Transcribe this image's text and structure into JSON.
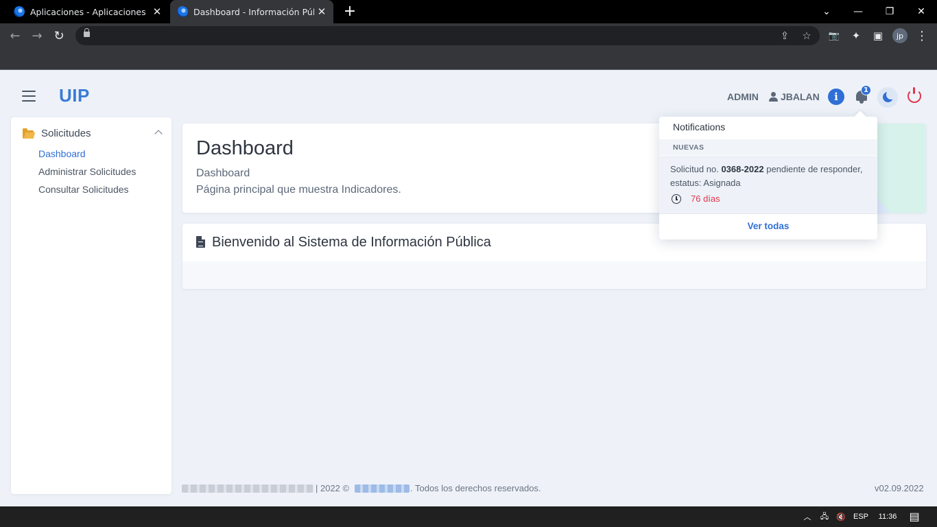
{
  "browser": {
    "tabs": [
      {
        "title": "Aplicaciones - Aplicaciones",
        "close": "✕"
      },
      {
        "title": "Dashboard - Información Pública",
        "close": "✕"
      }
    ],
    "new_tab": "+",
    "window_controls": {
      "minimize": "⌄",
      "min_line": "—",
      "restore": "❐",
      "close": "✕"
    },
    "nav": {
      "back": "←",
      "forward": "→",
      "reload": "↻"
    },
    "omnibox_icons": {
      "share": "⇪",
      "star": "☆"
    },
    "toolbar_icons": {
      "camera": "📷",
      "puzzle": "✦",
      "sidebar": "▣",
      "menu": "⋮"
    },
    "profile_initials": "jp"
  },
  "app": {
    "logo": "UIP",
    "role": "ADMIN",
    "user": "JBALAN",
    "info_icon": "i",
    "notification_count": "1"
  },
  "sidebar": {
    "section": "Solicitudes",
    "items": [
      {
        "label": "Dashboard",
        "active": true
      },
      {
        "label": "Administrar Solicitudes",
        "active": false
      },
      {
        "label": "Consultar Solicitudes",
        "active": false
      }
    ]
  },
  "main": {
    "title": "Dashboard",
    "subtitle": "Dashboard",
    "description": "Página principal que muestra Indicadores.",
    "welcome": "Bienvenido al Sistema de Información Pública"
  },
  "notifications": {
    "title": "Notifications",
    "section": "NUEVAS",
    "item": {
      "prefix": "Solicitud no. ",
      "number": "0368-2022",
      "suffix": " pendiente de responder, estatus: Asignada",
      "time": "76 días"
    },
    "view_all": "Ver todas"
  },
  "footer": {
    "copyright": "| 2022 ©",
    "rights": ". Todos los derechos reservados.",
    "version": "v02.09.2022"
  },
  "taskbar": {
    "caret": "︿",
    "network": "🖧",
    "volume": "🔇",
    "language": "ESP",
    "time": "11:36",
    "action_center": "▤"
  },
  "colors": {
    "accent": "#2f6fd6",
    "danger": "#e0344b",
    "folder": "#e3a02a",
    "background": "#eef2f8"
  }
}
